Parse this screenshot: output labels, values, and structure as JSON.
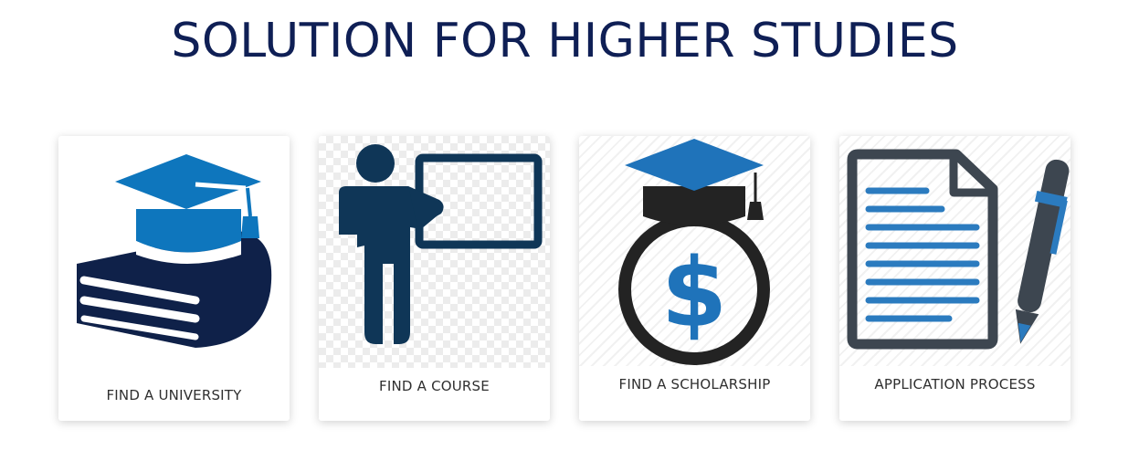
{
  "page": {
    "title": "SOLUTION FOR HIGHER STUDIES"
  },
  "cards": [
    {
      "label": "FIND A UNIVERSITY",
      "icon": "graduation-cap-books-icon"
    },
    {
      "label": "FIND A COURSE",
      "icon": "teacher-board-icon"
    },
    {
      "label": "FIND A SCHOLARSHIP",
      "icon": "scholarship-money-bag-icon"
    },
    {
      "label": "APPLICATION PROCESS",
      "icon": "document-pen-icon"
    }
  ],
  "colors": {
    "title": "#0f1f55",
    "navy": "#0f2149",
    "blue": "#0e76bd",
    "dark_teal": "#0f3657",
    "charcoal": "#3d4650",
    "doc_blue": "#2b7bbf"
  }
}
